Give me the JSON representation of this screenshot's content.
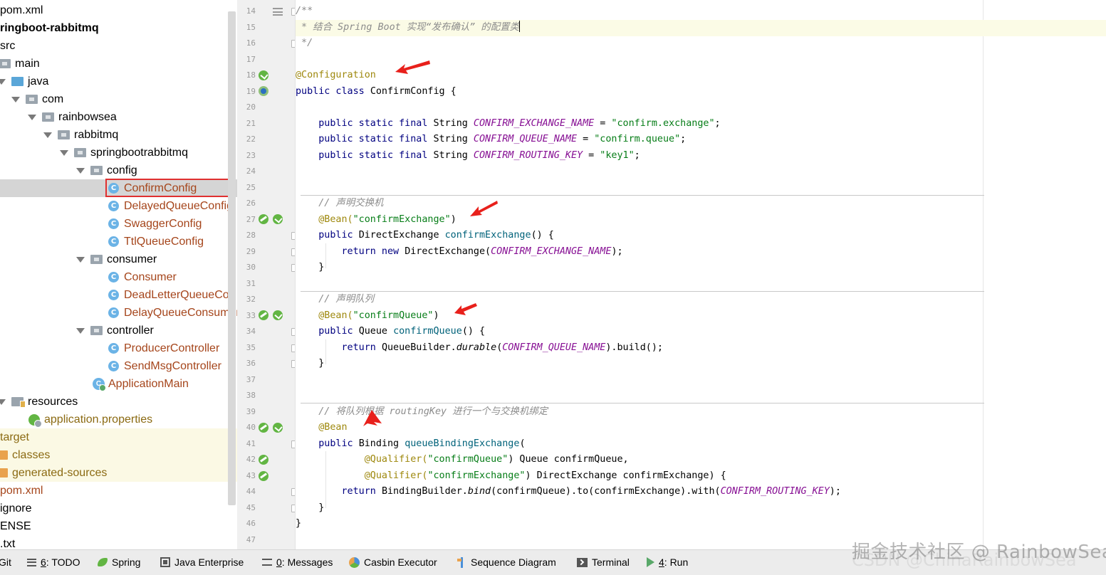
{
  "project_tree": [
    {
      "label": "pom.xml",
      "style": "plain"
    },
    {
      "label": "ringboot-rabbitmq",
      "style": "bold"
    },
    {
      "label": "src",
      "style": "plain"
    },
    {
      "label": "main",
      "style": "plain"
    },
    {
      "label": "java",
      "style": "plain"
    },
    {
      "label": "com",
      "style": "plain"
    },
    {
      "label": "rainbowsea",
      "style": "plain"
    },
    {
      "label": "rabbitmq",
      "style": "plain"
    },
    {
      "label": "springbootrabbitmq",
      "style": "plain"
    },
    {
      "label": "config",
      "style": "plain"
    },
    {
      "label": "ConfirmConfig",
      "style": "class"
    },
    {
      "label": "DelayedQueueConfig",
      "style": "class"
    },
    {
      "label": "SwaggerConfig",
      "style": "class"
    },
    {
      "label": "TtlQueueConfig",
      "style": "class"
    },
    {
      "label": "consumer",
      "style": "plain"
    },
    {
      "label": "Consumer",
      "style": "class"
    },
    {
      "label": "DeadLetterQueueCon",
      "style": "class"
    },
    {
      "label": "DelayQueueConsumer",
      "style": "class"
    },
    {
      "label": "controller",
      "style": "plain"
    },
    {
      "label": "ProducerController",
      "style": "class"
    },
    {
      "label": "SendMsgController",
      "style": "class"
    },
    {
      "label": "ApplicationMain",
      "style": "class"
    },
    {
      "label": "resources",
      "style": "plain"
    },
    {
      "label": "application.properties",
      "style": "olive"
    },
    {
      "label": "target",
      "style": "olive"
    },
    {
      "label": "classes",
      "style": "olive"
    },
    {
      "label": "generated-sources",
      "style": "olive"
    },
    {
      "label": "pom.xml",
      "style": "brown"
    },
    {
      "label": "ignore",
      "style": "plain"
    },
    {
      "label": "ENSE",
      "style": "plain"
    },
    {
      "label": ".txt",
      "style": "plain"
    }
  ],
  "gutter": {
    "line_numbers": [
      "14",
      "15",
      "16",
      "17",
      "18",
      "19",
      "20",
      "21",
      "22",
      "23",
      "24",
      "25",
      "26",
      "27",
      "28",
      "29",
      "30",
      "31",
      "32",
      "33",
      "34",
      "35",
      "36",
      "37",
      "38",
      "39",
      "40",
      "41",
      "42",
      "43",
      "44",
      "45",
      "46",
      "47"
    ]
  },
  "editor": {
    "l14": "/**",
    "l15": " * 结合 Spring Boot 实现“发布确认” 的配置类",
    "l16": " */",
    "l18": "@Configuration",
    "l19_kw": "public class ",
    "l19_name": "ConfirmConfig {",
    "l21_kw": "    public static final ",
    "l21_type": "String ",
    "l21_const": "CONFIRM_EXCHANGE_NAME",
    "l21_eq": " = ",
    "l21_str": "\"confirm.exchange\"",
    "l21_end": ";",
    "l22_kw": "    public static final ",
    "l22_type": "String ",
    "l22_const": "CONFIRM_QUEUE_NAME",
    "l22_eq": " = ",
    "l22_str": "\"confirm.queue\"",
    "l22_end": ";",
    "l23_kw": "    public static final ",
    "l23_type": "String ",
    "l23_const": "CONFIRM_ROUTING_KEY",
    "l23_eq": " = ",
    "l23_str": "\"key1\"",
    "l23_end": ";",
    "l26": "    // 声明交换机",
    "l27_ann": "    @Bean(",
    "l27_str": "\"confirmExchange\"",
    "l27_end": ")",
    "l28_kw": "    public ",
    "l28_type": "DirectExchange ",
    "l28_fn": "confirmExchange",
    "l28_end": "() {",
    "l29_kw": "        return new ",
    "l29_type": "DirectExchange(",
    "l29_const": "CONFIRM_EXCHANGE_NAME",
    "l29_end": ");",
    "l30": "    }",
    "l32": "    // 声明队列",
    "l33_ann": "    @Bean(",
    "l33_str": "\"confirmQueue\"",
    "l33_end": ")",
    "l34_kw": "    public ",
    "l34_type": "Queue ",
    "l34_fn": "confirmQueue",
    "l34_end": "() {",
    "l35_kw": "        return ",
    "l35_a": "QueueBuilder.",
    "l35_sm": "durable",
    "l35_b": "(",
    "l35_const": "CONFIRM_QUEUE_NAME",
    "l35_end": ").build();",
    "l36": "    }",
    "l39": "    // 将队列根据 routingKey 进行一个与交换机绑定",
    "l40": "    @Bean",
    "l41_kw": "    public ",
    "l41_type": "Binding ",
    "l41_fn": "queueBindingExchange",
    "l41_end": "(",
    "l42_ann": "            @Qualifier(",
    "l42_str": "\"confirmQueue\"",
    "l42_end": ") Queue confirmQueue,",
    "l43_ann": "            @Qualifier(",
    "l43_str": "\"confirmExchange\"",
    "l43_end": ") DirectExchange confirmExchange) {",
    "l44_kw": "        return ",
    "l44_a": "BindingBuilder.",
    "l44_sm": "bind",
    "l44_b": "(confirmQueue).to(confirmExchange).with(",
    "l44_const": "CONFIRM_ROUTING_KEY",
    "l44_end": ");",
    "l45": "    }",
    "l46": "}"
  },
  "bottom_bar": {
    "git": "Git",
    "todo_num": "6",
    "todo": ": TODO",
    "spring": "Spring",
    "java_ee": "Java Enterprise",
    "messages_num": "0",
    "messages": ": Messages",
    "casbin": "Casbin Executor",
    "sequence": "Sequence Diagram",
    "terminal": "Terminal",
    "run_num": "4",
    "run": ": Run"
  },
  "watermark": {
    "line1": "掘金技术社区 @ RainbowSea",
    "line2": "CSDN @ChinaRainbowSea"
  },
  "colors": {
    "keyword": "#000080",
    "string": "#067d17",
    "constant": "#871094",
    "comment": "#8c8c8c",
    "annotation": "#9e880d",
    "method": "#00627a",
    "arrow": "#e8201b",
    "selection_box": "#e03030"
  }
}
